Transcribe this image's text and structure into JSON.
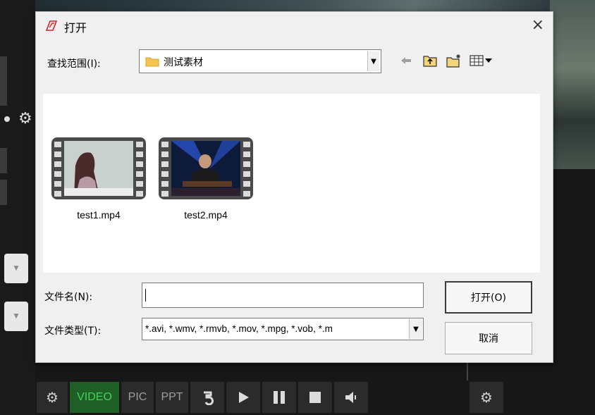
{
  "dialog": {
    "title": "打开",
    "close_symbol": "×",
    "look_in_label": "查找范围(I):",
    "current_folder": "测试素材",
    "files": [
      {
        "name": "test1.mp4",
        "icon": "video-file-icon"
      },
      {
        "name": "test2.mp4",
        "icon": "video-file-icon"
      }
    ],
    "filename_label": "文件名(N):",
    "filename_value": "",
    "filetype_label": "文件类型(T):",
    "filetype_value": "*.avi, *.wmv, *.rmvb, *.mov, *.mpg, *.vob, *.m",
    "open_button": "打开(O)",
    "cancel_button": "取消"
  },
  "toolbar": {
    "buttons": [
      {
        "label": "",
        "icon": "gear-icon"
      },
      {
        "label": "VIDEO",
        "active": true
      },
      {
        "label": "PIC"
      },
      {
        "label": "PPT"
      },
      {
        "label": "",
        "icon": "rewind-icon"
      },
      {
        "label": "",
        "icon": "play-icon"
      },
      {
        "label": "",
        "icon": "pause-icon"
      },
      {
        "label": "",
        "icon": "stop-icon"
      },
      {
        "label": "",
        "icon": "volume-icon"
      }
    ],
    "right_icon": "gear-icon"
  },
  "colors": {
    "active_green": "#3fd35a",
    "dialog_bg": "#f0f0f0",
    "app_bg": "#121212"
  }
}
